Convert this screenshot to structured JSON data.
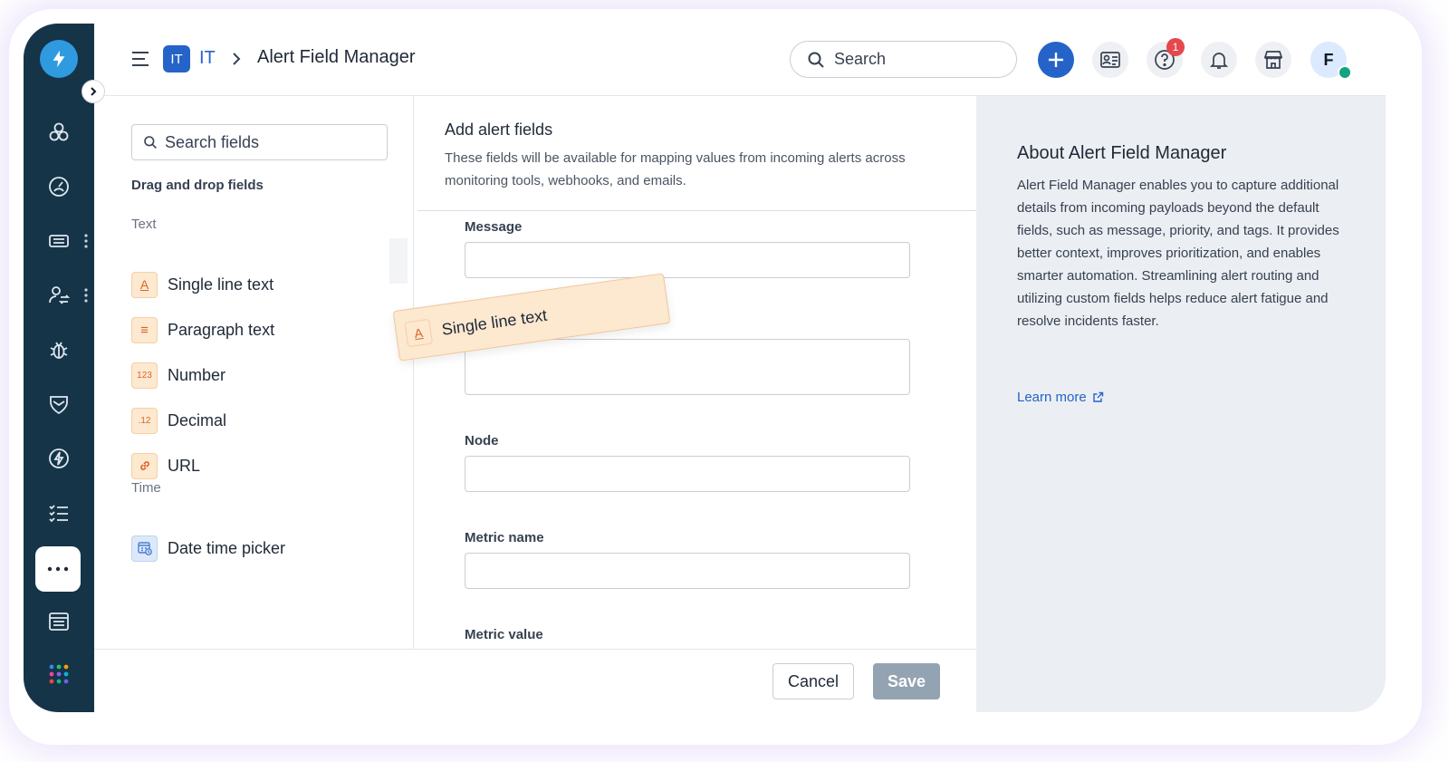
{
  "header": {
    "workspace_badge": "IT",
    "workspace_name": "IT",
    "page_title": "Alert Field Manager",
    "search_placeholder": "Search",
    "help_badge_count": "1",
    "avatar_initial": "F"
  },
  "fields_panel": {
    "search_placeholder": "Search fields",
    "heading": "Drag and drop fields",
    "groups": [
      {
        "label": "Text",
        "items": [
          {
            "label": "Single line text",
            "icon": "single-line-text-icon",
            "glyph": "A"
          },
          {
            "label": "Paragraph text",
            "icon": "paragraph-text-icon",
            "glyph": "≡"
          },
          {
            "label": "Number",
            "icon": "number-icon",
            "glyph": "123"
          },
          {
            "label": "Decimal",
            "icon": "decimal-icon",
            "glyph": ".12"
          },
          {
            "label": "URL",
            "icon": "link-icon",
            "glyph": "🔗"
          }
        ]
      },
      {
        "label": "Time",
        "items": [
          {
            "label": "Date time picker",
            "icon": "calendar-clock-icon",
            "glyph": "▦"
          }
        ]
      }
    ]
  },
  "form": {
    "title": "Add alert fields",
    "description": "These fields will be available for mapping values from incoming alerts across monitoring tools, webhooks, and emails.",
    "fields": [
      {
        "label": "Message"
      },
      {
        "label": ""
      },
      {
        "label": "Node"
      },
      {
        "label": "Metric name"
      },
      {
        "label": "Metric value"
      }
    ]
  },
  "drag_card": {
    "label": "Single line text",
    "glyph": "A"
  },
  "footer": {
    "cancel_label": "Cancel",
    "save_label": "Save"
  },
  "about": {
    "title": "About Alert Field Manager",
    "body": "Alert Field Manager enables you to capture additional details from incoming payloads beyond the default fields, such as message, priority, and tags. It provides better context, improves prioritization, and enables smarter automation. Streamlining alert routing and utilizing custom fields helps reduce alert fatigue and resolve incidents faster.",
    "learn_more": "Learn more"
  },
  "colors": {
    "rail": "#153448",
    "accent": "#2563c9",
    "field_icon_bg": "#fde8d0",
    "save_disabled": "#93a3b2",
    "about_bg": "#ebeef2"
  }
}
